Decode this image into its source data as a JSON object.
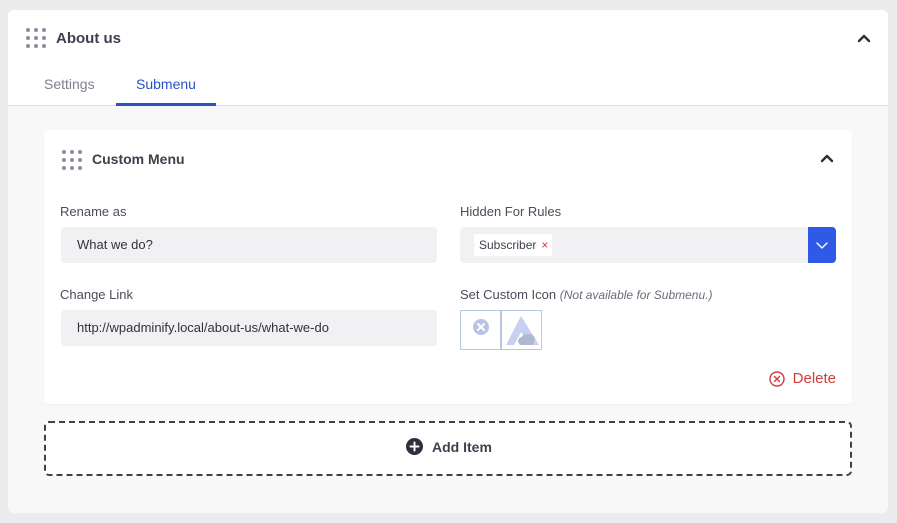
{
  "section": {
    "title": "About us",
    "tabs": [
      {
        "label": "Settings",
        "active": false
      },
      {
        "label": "Submenu",
        "active": true
      }
    ]
  },
  "menu_item": {
    "title": "Custom Menu",
    "rename_label": "Rename as",
    "rename_value": "What we do?",
    "hidden_rules_label": "Hidden For Rules",
    "hidden_rules_tags": [
      "Subscriber"
    ],
    "tag_remove_symbol": "×",
    "change_link_label": "Change Link",
    "change_link_value": "http://wpadminify.local/about-us/what-we-do",
    "custom_icon_label": "Set Custom Icon",
    "custom_icon_note": "(Not available for Submenu.)",
    "delete_label": "Delete"
  },
  "add_item_label": "Add Item",
  "colors": {
    "accent": "#2a52c7",
    "select_button": "#2f5ae8",
    "delete": "#d33c3c"
  },
  "icons": [
    "drag-handle-icon",
    "chevron-up-icon",
    "chevron-down-icon",
    "clear-icon",
    "cloud-logo-icon",
    "close-circle-icon",
    "plus-circle-icon"
  ]
}
